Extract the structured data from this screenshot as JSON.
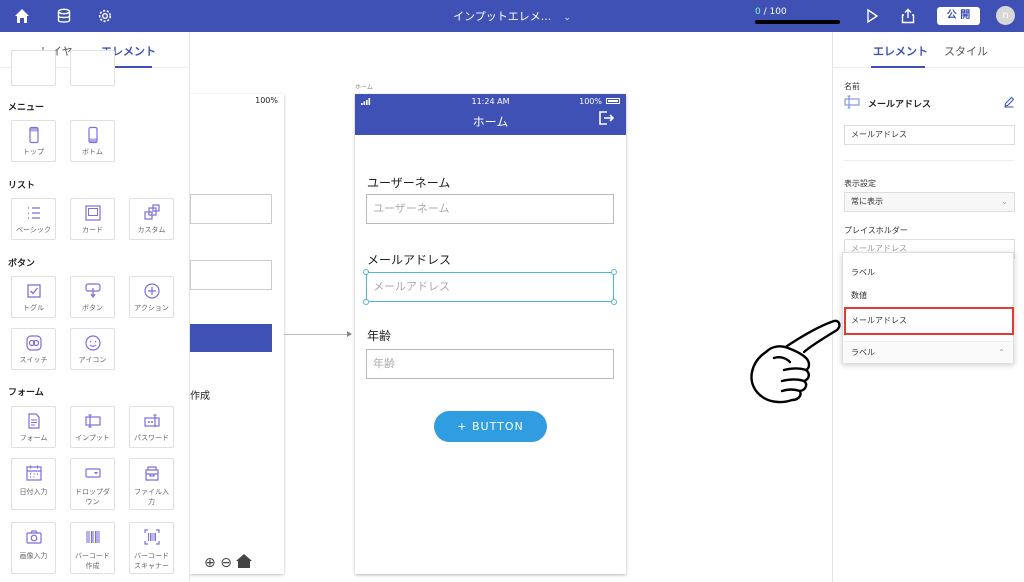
{
  "topbar": {
    "title": "インプットエレメ...",
    "title_chevron": "⌄",
    "progress_current": "0",
    "progress_total": "/ 100",
    "publish_label": "公 開",
    "avatar_initial": "n",
    "icons": [
      "home-icon",
      "database-icon",
      "gear-icon",
      "play-icon",
      "share-icon"
    ],
    "colors": {
      "bar": "#3f51b5",
      "progress_value": "#7CFFB2"
    }
  },
  "left_panel": {
    "tabs": [
      "レイヤー",
      "エレメント"
    ],
    "active_tab": "エレメント",
    "sections": {
      "menu": "メニュー",
      "list": "リスト",
      "button": "ボタン",
      "form": "フォーム"
    },
    "tiles": {
      "top": "トップ",
      "bottom": "ボトム",
      "basic": "ベーシック",
      "card": "カード",
      "custom": "カスタム",
      "toggle": "トグル",
      "button": "ボタン",
      "action": "アクション",
      "switch": "スイッチ",
      "icon": "アイコン",
      "form": "フォーム",
      "input": "インプット",
      "password": "パスワード",
      "date": "日付入力",
      "dropdown_1": "ドロップダ",
      "dropdown_2": "ウン",
      "file_1": "ファイル入",
      "file_2": "力",
      "image": "画像入力",
      "barcode_make_1": "バーコード",
      "barcode_make_2": "作成",
      "barcode_scan_1": "バーコード",
      "barcode_scan_2": "スキャナー"
    }
  },
  "canvas": {
    "left_phone": {
      "battery": "100%",
      "partial_text": "作成"
    },
    "screen_name": "ホーム",
    "phone": {
      "time": "11:24 AM",
      "battery": "100%",
      "title": "ホーム",
      "fields": [
        {
          "label": "ユーザーネーム",
          "placeholder": "ユーザーネーム"
        },
        {
          "label": "メールアドレス",
          "placeholder": "メールアドレス"
        },
        {
          "label": "年齢",
          "placeholder": "年齢"
        }
      ],
      "button_label": "+   BUTTON"
    }
  },
  "right_panel": {
    "tabs": [
      "エレメント",
      "スタイル"
    ],
    "active_tab": "エレメント",
    "name_label": "名前",
    "element_name": "メールアドレス",
    "name_input": "メールアドレス",
    "display_label": "表示設定",
    "display_value": "常に表示",
    "placeholder_label": "プレイスホルダー",
    "placeholder_value": "メールアドレス",
    "dropdown": {
      "options": [
        "ラベル",
        "数値",
        "メールアドレス"
      ],
      "highlighted": "メールアドレス",
      "current": "ラベル",
      "highlight_color": "#e53935"
    }
  }
}
